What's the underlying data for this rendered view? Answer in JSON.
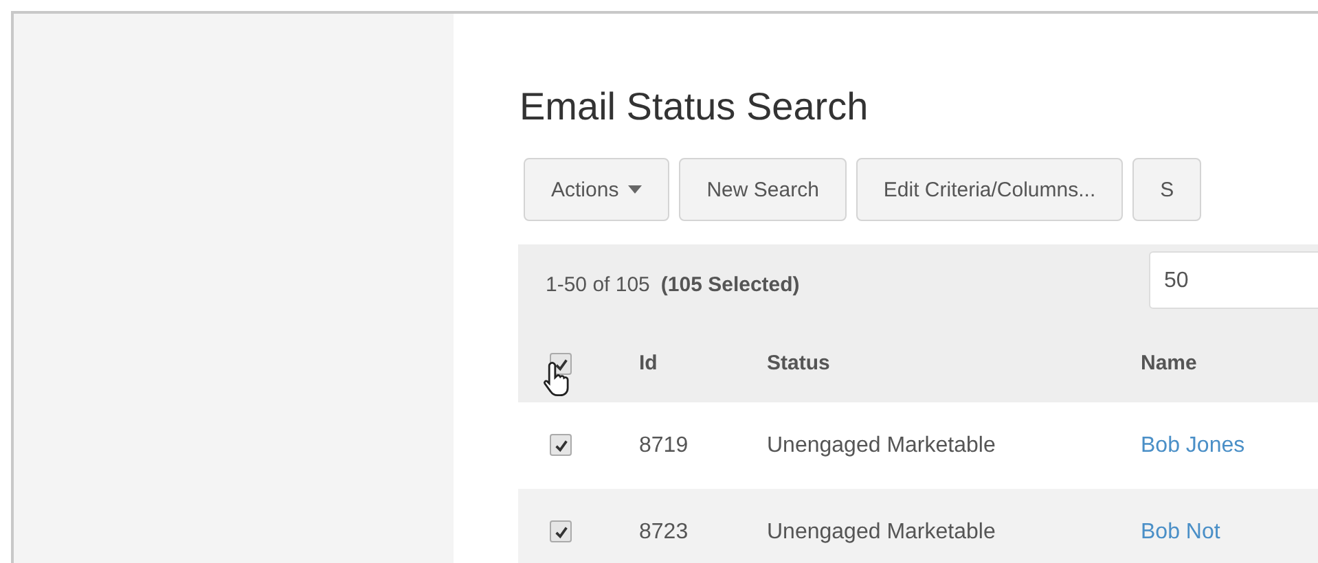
{
  "page": {
    "title": "Email Status Search"
  },
  "toolbar": [
    {
      "label": "Actions",
      "kind": "dropdown"
    },
    {
      "label": "New Search",
      "kind": "button"
    },
    {
      "label": "Edit Criteria/Columns...",
      "kind": "button"
    },
    {
      "label": "S",
      "kind": "button"
    }
  ],
  "summary": {
    "range": "1-50 of 105",
    "selected": "(105 Selected)",
    "page_size": "50"
  },
  "table": {
    "select_all": {
      "checked": true
    },
    "columns": [
      "Id",
      "Status",
      "Name"
    ],
    "rows": [
      {
        "checked": true,
        "id": "8719",
        "status": "Unengaged Marketable",
        "name": "Bob Jones"
      },
      {
        "checked": true,
        "id": "8723",
        "status": "Unengaged Marketable",
        "name": "Bob Not"
      }
    ]
  }
}
